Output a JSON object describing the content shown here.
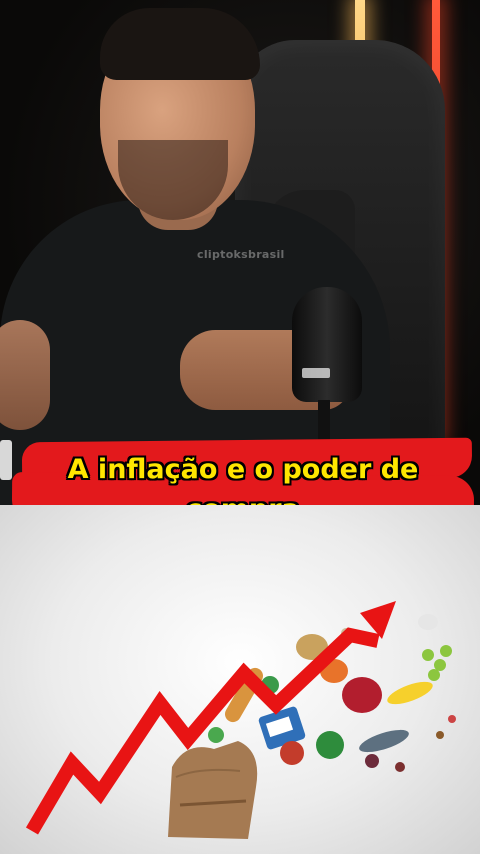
{
  "caption": {
    "line1": "A inflação e o poder de",
    "line2": "compra"
  },
  "watermark": "cliptoksbrasil",
  "colors": {
    "banner_red": "#e3191c",
    "caption_yellow": "#ffe600",
    "arrow_red": "#e81414"
  },
  "illustration": {
    "subject": "rising-price-arrow-with-groceries-icon"
  }
}
